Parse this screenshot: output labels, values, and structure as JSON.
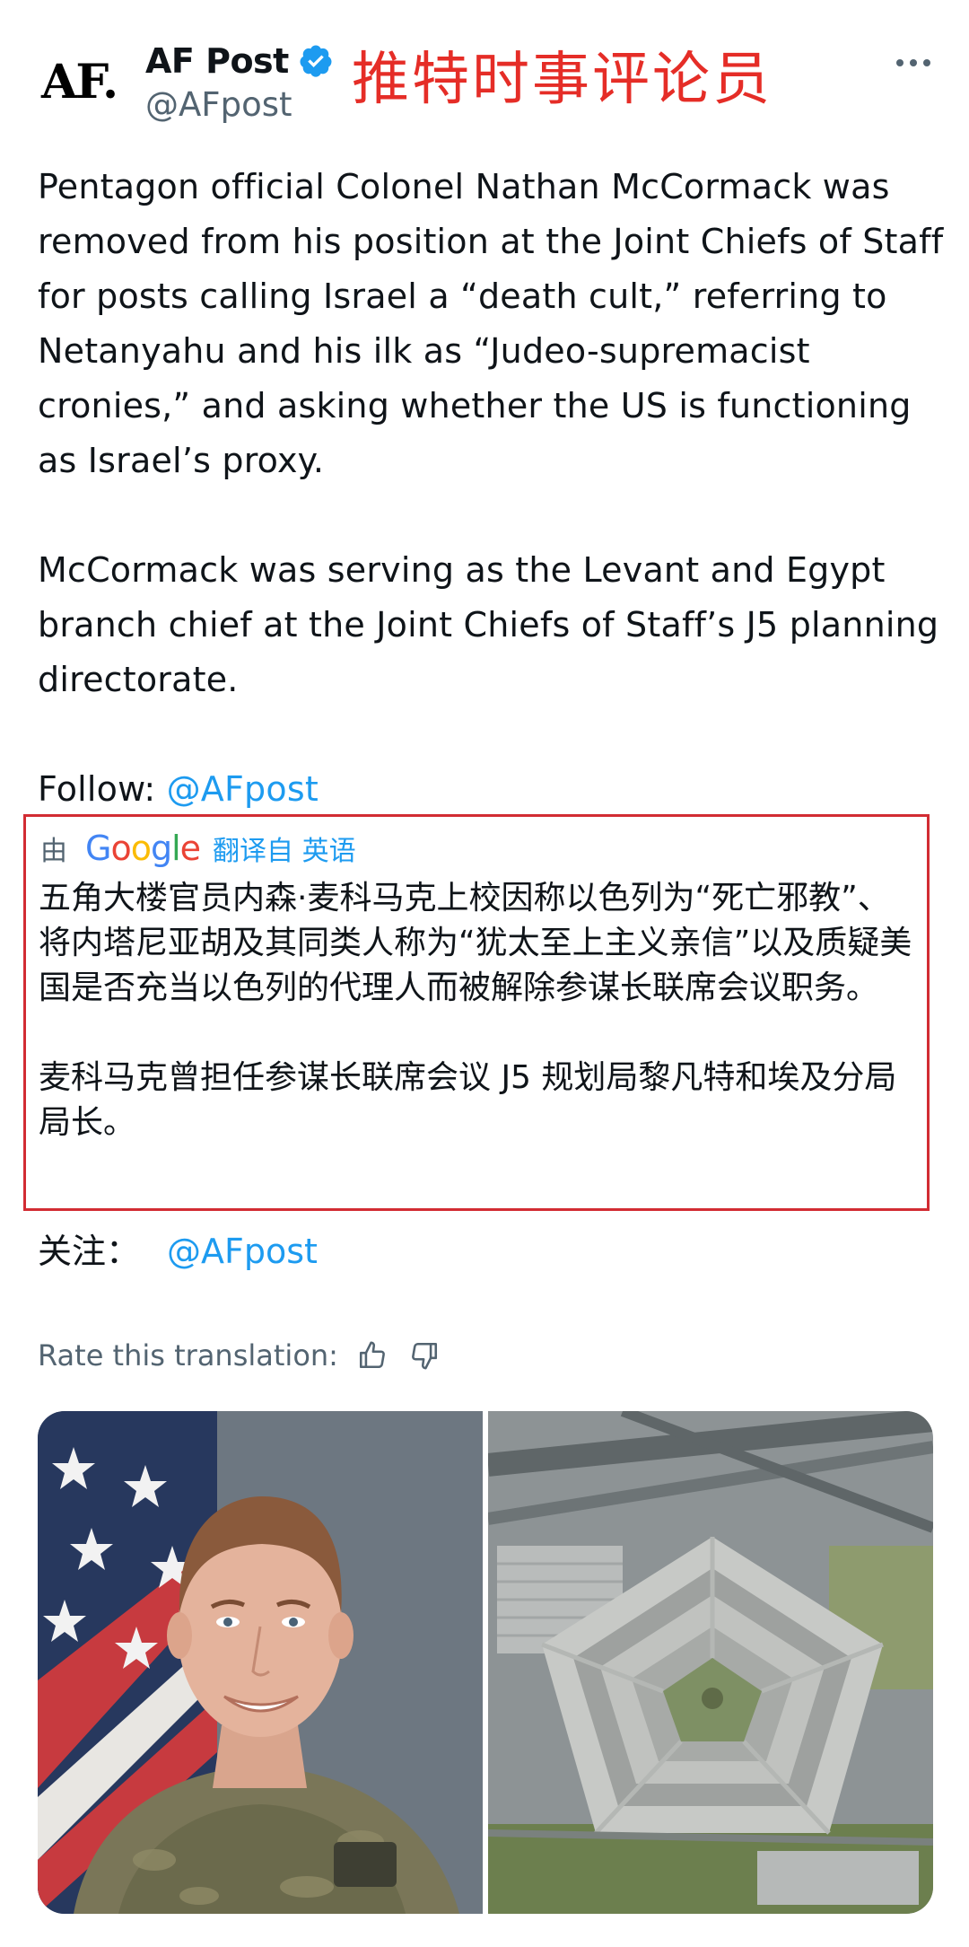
{
  "author": {
    "logo_text": "AF.",
    "display_name": "AF Post",
    "handle": "@AFpost",
    "verified": true
  },
  "overlay_caption": "推特时事评论员",
  "tweet": {
    "paragraph_1": "Pentagon official Colonel Nathan McCormack was removed from his position at the Joint Chiefs of Staff for posts calling Israel a “death cult,” referring to Netanyahu and his ilk as “Judeo-supremacist cronies,” and asking whether the US is functioning as Israel’s proxy.",
    "paragraph_2": "McCormack was serving as the Levant and Egypt branch chief at the Joint Chiefs of Staff’s J5 planning directorate.",
    "follow_label": "Follow: ",
    "follow_link": "@AFpost"
  },
  "translation": {
    "by_label": "由",
    "provider": "Google",
    "translated_from": "翻译自 英语",
    "paragraph_1": "五角大楼官员内森·麦科马克上校因称以色列为“死亡邪教”、将内塔尼亚胡及其同类人称为“犹太至上主义亲信”以及质疑美国是否充当以色列的代理人而被解除参谋长联席会议职务。",
    "paragraph_2": "麦科马克曾担任参谋长联席会议 J5 规划局黎凡特和埃及分局局长。",
    "follow_label": "关注：",
    "follow_link": "@AFpost"
  },
  "rate": {
    "label": "Rate this translation:"
  },
  "icons": {
    "verified": "verified-badge-icon",
    "more": "more-icon",
    "thumbs_up": "thumbs-up-icon",
    "thumbs_down": "thumbs-down-icon"
  },
  "colors": {
    "link": "#1d9bf0",
    "verified": "#1d9bf0",
    "highlight_border": "#d22c33",
    "overlay_text": "#e52d27",
    "secondary_text": "#536471"
  }
}
